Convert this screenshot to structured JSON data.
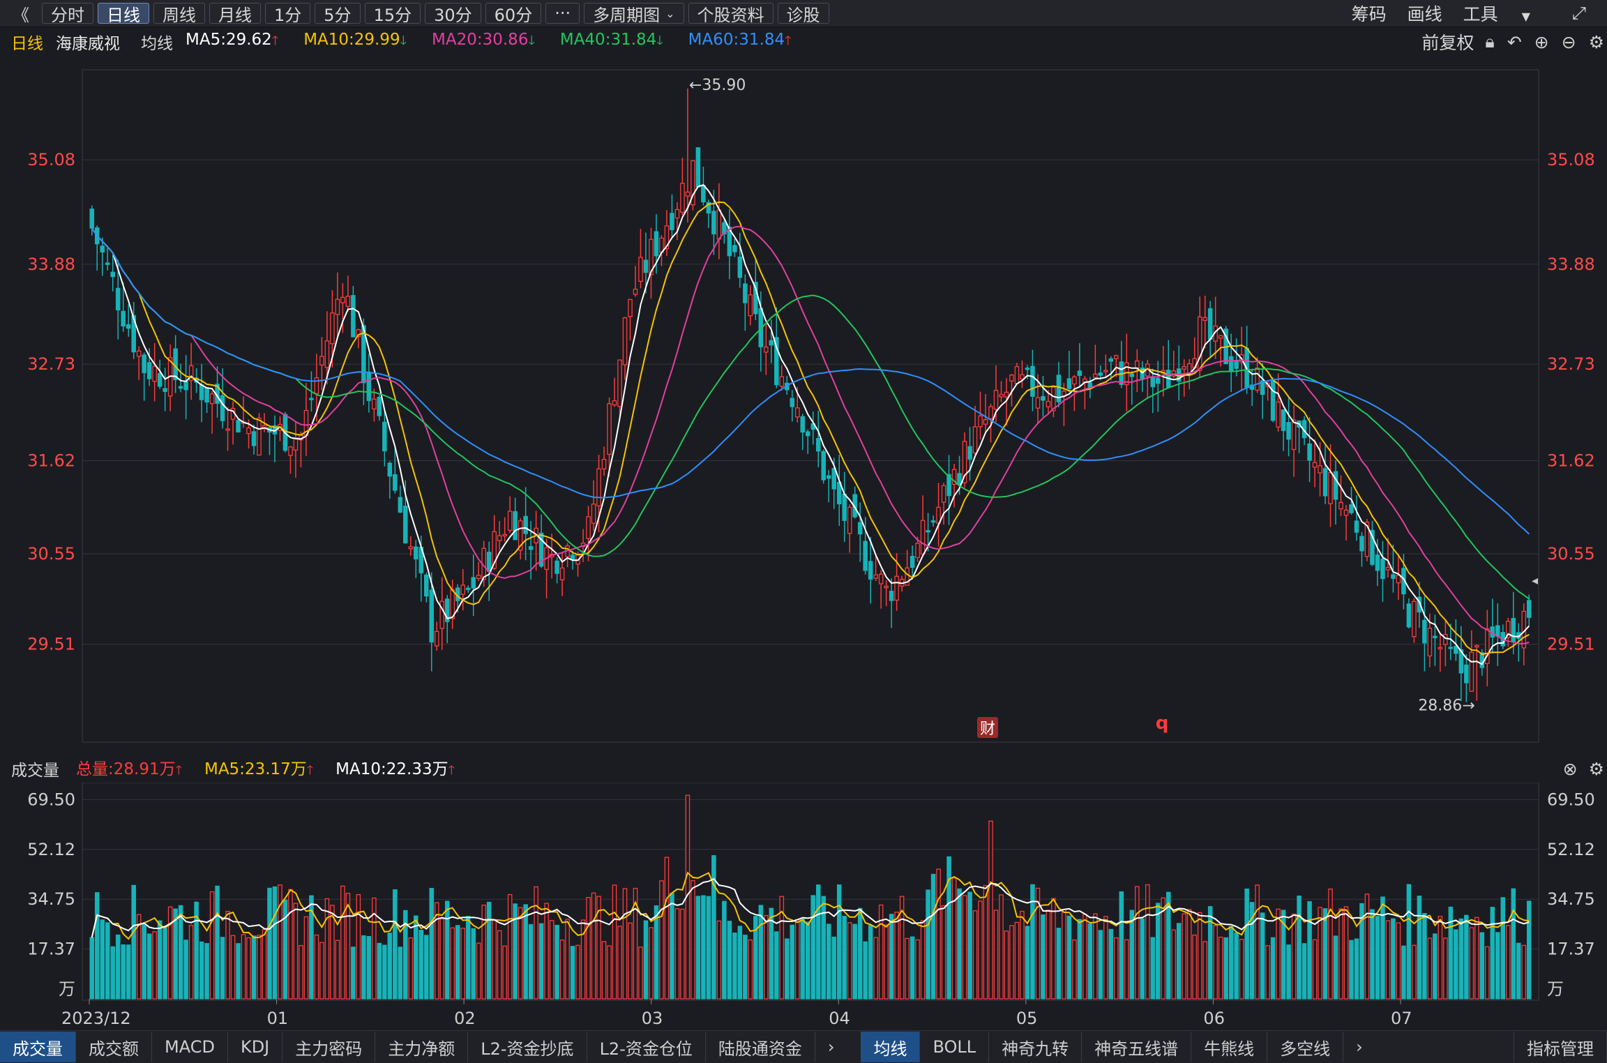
{
  "toolbar": {
    "collapse": "《",
    "periods": [
      "分时",
      "日线",
      "周线",
      "月线",
      "1分",
      "5分",
      "15分",
      "30分",
      "60分",
      "···",
      "多周期图",
      "个股资料",
      "诊股"
    ],
    "active_period": "日线",
    "right": [
      "筹码",
      "画线",
      "工具"
    ],
    "icons": [
      "fullscreen-icon"
    ]
  },
  "ma_line": {
    "period": "日线",
    "stock": "海康威视",
    "label": "均线",
    "ma5": "MA5:29.62",
    "ma10": "MA10:29.99",
    "ma20": "MA20:30.86",
    "ma40": "MA40:31.84",
    "ma60": "MA60:31.84",
    "restore": "前复权",
    "colors": {
      "ma5": "#ffffff",
      "ma10": "#f5c400",
      "ma20": "#e040a0",
      "ma40": "#22c55e",
      "ma60": "#2f8fff"
    }
  },
  "vol_line": {
    "label": "成交量",
    "total": "总量:28.91万",
    "ma5": "MA5:23.17万",
    "ma10": "MA10:22.33万"
  },
  "chart_data": {
    "type": "candlestick",
    "price_axis": [
      "35.08",
      "33.88",
      "32.73",
      "31.62",
      "30.55",
      "29.51"
    ],
    "price_range": [
      28.4,
      36.1
    ],
    "volume_axis": [
      "69.50",
      "52.12",
      "34.75",
      "17.37",
      "万"
    ],
    "volume_range": [
      0,
      73
    ],
    "x_axis_labels": [
      "2023/12",
      "01",
      "02",
      "03",
      "04",
      "05",
      "06",
      "07"
    ],
    "annotations": {
      "high": "←35.90",
      "low": "28.86→",
      "marker_cai": "财",
      "marker_q": "q"
    },
    "colors": {
      "up": "#ff3b3b",
      "down": "#17b3b8",
      "grid": "#34353d"
    }
  },
  "bottom_tabs_left": [
    "成交量",
    "成交额",
    "MACD",
    "KDJ",
    "主力密码",
    "主力净额",
    "L2-资金抄底",
    "L2-资金仓位",
    "陆股通资金"
  ],
  "bottom_tabs_right": [
    "均线",
    "BOLL",
    "神奇九转",
    "神奇五线谱",
    "牛熊线",
    "多空线"
  ],
  "bottom_manage": "指标管理"
}
